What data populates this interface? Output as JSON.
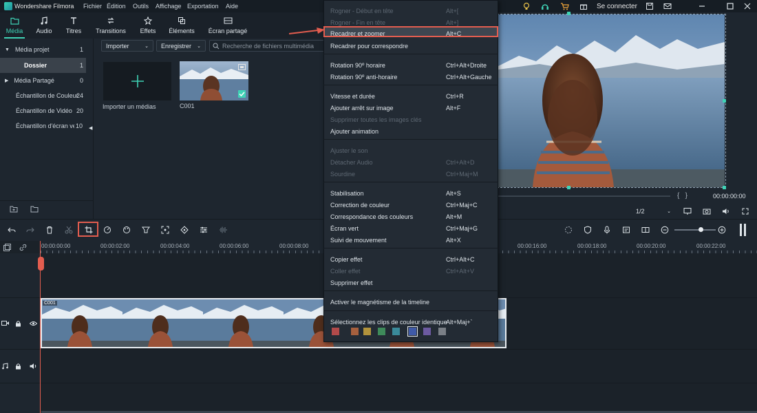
{
  "app": {
    "name": "Wondershare Filmora"
  },
  "menu": [
    "Fichier",
    "Édition",
    "Outils",
    "Affichage",
    "Exportation",
    "Aide"
  ],
  "topright": {
    "login_label": "Se connecter"
  },
  "tabs": [
    {
      "label": "Média",
      "icon": "folder-icon"
    },
    {
      "label": "Audio",
      "icon": "music-note-icon"
    },
    {
      "label": "Titres",
      "icon": "text-t-icon"
    },
    {
      "label": "Transitions",
      "icon": "transitions-icon"
    },
    {
      "label": "Effets",
      "icon": "effects-icon"
    },
    {
      "label": "Éléments",
      "icon": "elements-icon"
    },
    {
      "label": "Écran partagé",
      "icon": "split-screen-icon"
    }
  ],
  "sidebar": {
    "items": [
      {
        "label": "Média projet",
        "count": "1"
      },
      {
        "label": "Dossier",
        "count": "1"
      },
      {
        "label": "Média Partagé",
        "count": "0"
      },
      {
        "label": "Échantillon de Couleur",
        "count": "24"
      },
      {
        "label": "Échantillon de Vidéo",
        "count": "20"
      },
      {
        "label": "Échantillon d'écran ve",
        "count": "10"
      }
    ]
  },
  "media": {
    "import_label": "Importer",
    "save_label": "Enregistrer",
    "search_placeholder": "Recherche de fichiers multimédia",
    "import_tile_label": "Importer un médias",
    "clip_label": "C001"
  },
  "context_menu": {
    "items": [
      {
        "label": "Rogner - Début en tête",
        "shortcut": "Alt+[",
        "disabled": true
      },
      {
        "label": "Rogner - Fin en tête",
        "shortcut": "Alt+]",
        "disabled": true
      },
      {
        "label": "Recadrer et zoomer",
        "shortcut": "Alt+C",
        "disabled": false,
        "highlighted": true
      },
      {
        "label": "Recadrer pour correspondre",
        "shortcut": "",
        "disabled": false
      },
      {
        "label": "Rotation 90º horaire",
        "shortcut": "Ctrl+Alt+Droite",
        "disabled": false
      },
      {
        "label": "Rotation 90º anti-horaire",
        "shortcut": "Ctrl+Alt+Gauche",
        "disabled": false
      },
      {
        "label": "Vitesse et durée",
        "shortcut": "Ctrl+R",
        "disabled": false
      },
      {
        "label": "Ajouter arrêt sur image",
        "shortcut": "Alt+F",
        "disabled": false
      },
      {
        "label": "Supprimer toutes les images clés",
        "shortcut": "",
        "disabled": true
      },
      {
        "label": "Ajouter animation",
        "shortcut": "",
        "disabled": false
      },
      {
        "label": "Ajuster le son",
        "shortcut": "",
        "disabled": true
      },
      {
        "label": "Détacher Audio",
        "shortcut": "Ctrl+Alt+D",
        "disabled": true
      },
      {
        "label": "Sourdine",
        "shortcut": "Ctrl+Maj+M",
        "disabled": true
      },
      {
        "label": "Stabilisation",
        "shortcut": "Alt+S",
        "disabled": false
      },
      {
        "label": "Correction de couleur",
        "shortcut": "Ctrl+Maj+C",
        "disabled": false
      },
      {
        "label": "Correspondance des couleurs",
        "shortcut": "Alt+M",
        "disabled": false
      },
      {
        "label": "Écran vert",
        "shortcut": "Ctrl+Maj+G",
        "disabled": false
      },
      {
        "label": "Suivi de mouvement",
        "shortcut": "Alt+X",
        "disabled": false
      },
      {
        "label": "Copier effet",
        "shortcut": "Ctrl+Alt+C",
        "disabled": false
      },
      {
        "label": "Coller effet",
        "shortcut": "Ctrl+Alt+V",
        "disabled": true
      },
      {
        "label": "Supprimer effet",
        "shortcut": "",
        "disabled": false
      },
      {
        "label": "Activer le magnétisme de la timeline",
        "shortcut": "",
        "disabled": false
      },
      {
        "label": "Sélectionnez les clips de couleur identique",
        "shortcut": "Alt+Maj+`",
        "disabled": false
      }
    ],
    "swatches": [
      "#b14a4a",
      "#a6603e",
      "#b2933c",
      "#3e8a5a",
      "#3a8a9a",
      "#3f5aa8",
      "#6c5aa0",
      "#7a7f86"
    ]
  },
  "preview": {
    "timecode": "00:00:00:00",
    "zoom": "1/2",
    "brackets": "{   }"
  },
  "timeline": {
    "ruler_labels": [
      "00:00:00:00",
      "00:00:02:00",
      "00:00:04:00",
      "00:00:06:00",
      "00:00:08:00",
      "00:00:16:00",
      "00:00:18:00",
      "00:00:20:00",
      "00:00:22:00"
    ],
    "clip_label": "C001"
  },
  "colors": {
    "accent": "#3fd3b6",
    "highlight": "#e35d4f"
  }
}
